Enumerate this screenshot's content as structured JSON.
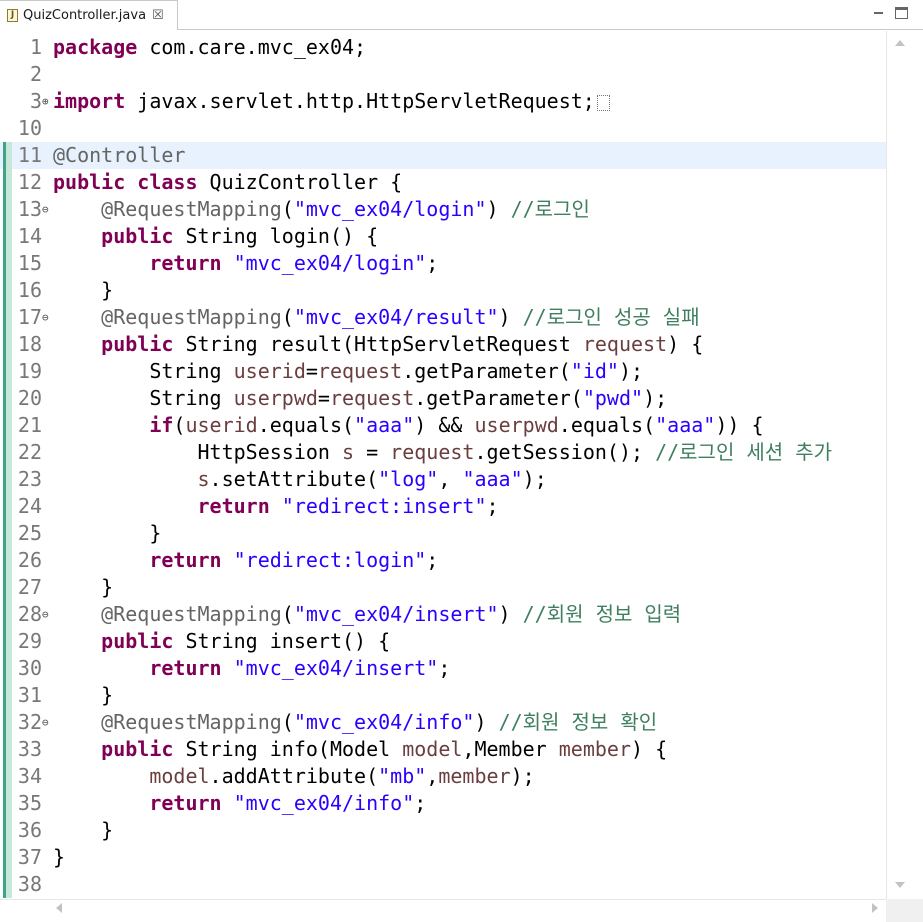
{
  "tab": {
    "file_name": "QuizController.java",
    "icon": "java-file-icon",
    "close_glyph": "☒"
  },
  "colors": {
    "keyword": "#7f0055",
    "string": "#2a00ff",
    "annotation": "#646464",
    "comment": "#3f7f5f",
    "field": "#6a3e3e",
    "current_line": "#e8f2fe"
  },
  "editor": {
    "current_line": 11,
    "lines": [
      {
        "n": "1",
        "t": [
          [
            "kw",
            "package"
          ],
          [
            "p",
            " com.care.mvc_ex04;"
          ]
        ]
      },
      {
        "n": "2",
        "t": []
      },
      {
        "n": "3",
        "fold": "⊕",
        "t": [
          [
            "kw",
            "import"
          ],
          [
            "p",
            " javax.servlet.http.HttpServletRequest;"
          ]
        ],
        "elided": true
      },
      {
        "n": "10",
        "t": []
      },
      {
        "n": "11",
        "t": [
          [
            "ann",
            "@Controller"
          ]
        ]
      },
      {
        "n": "12",
        "t": [
          [
            "kw",
            "public"
          ],
          [
            "p",
            " "
          ],
          [
            "kw",
            "class"
          ],
          [
            "p",
            " QuizController {"
          ]
        ]
      },
      {
        "n": "13",
        "fold": "⊖",
        "t": [
          [
            "p",
            "    "
          ],
          [
            "ann",
            "@RequestMapping"
          ],
          [
            "p",
            "("
          ],
          [
            "str",
            "\"mvc_ex04/login\""
          ],
          [
            "p",
            ") "
          ],
          [
            "cm",
            "//로그인"
          ]
        ]
      },
      {
        "n": "14",
        "t": [
          [
            "p",
            "    "
          ],
          [
            "kw",
            "public"
          ],
          [
            "p",
            " String login() {"
          ]
        ]
      },
      {
        "n": "15",
        "t": [
          [
            "p",
            "        "
          ],
          [
            "kw",
            "return"
          ],
          [
            "p",
            " "
          ],
          [
            "str",
            "\"mvc_ex04/login\""
          ],
          [
            "p",
            ";"
          ]
        ]
      },
      {
        "n": "16",
        "t": [
          [
            "p",
            "    }"
          ]
        ]
      },
      {
        "n": "17",
        "fold": "⊖",
        "t": [
          [
            "p",
            "    "
          ],
          [
            "ann",
            "@RequestMapping"
          ],
          [
            "p",
            "("
          ],
          [
            "str",
            "\"mvc_ex04/result\""
          ],
          [
            "p",
            ") "
          ],
          [
            "cm",
            "//로그인 성공 실패"
          ]
        ]
      },
      {
        "n": "18",
        "t": [
          [
            "p",
            "    "
          ],
          [
            "kw",
            "public"
          ],
          [
            "p",
            " String result(HttpServletRequest "
          ],
          [
            "fld",
            "request"
          ],
          [
            "p",
            ") {"
          ]
        ]
      },
      {
        "n": "19",
        "t": [
          [
            "p",
            "        String "
          ],
          [
            "fld",
            "userid"
          ],
          [
            "p",
            "="
          ],
          [
            "fld",
            "request"
          ],
          [
            "p",
            ".getParameter("
          ],
          [
            "str",
            "\"id\""
          ],
          [
            "p",
            ");"
          ]
        ]
      },
      {
        "n": "20",
        "t": [
          [
            "p",
            "        String "
          ],
          [
            "fld",
            "userpwd"
          ],
          [
            "p",
            "="
          ],
          [
            "fld",
            "request"
          ],
          [
            "p",
            ".getParameter("
          ],
          [
            "str",
            "\"pwd\""
          ],
          [
            "p",
            ");"
          ]
        ]
      },
      {
        "n": "21",
        "t": [
          [
            "p",
            "        "
          ],
          [
            "kw",
            "if"
          ],
          [
            "p",
            "("
          ],
          [
            "fld",
            "userid"
          ],
          [
            "p",
            ".equals("
          ],
          [
            "str",
            "\"aaa\""
          ],
          [
            "p",
            ") && "
          ],
          [
            "fld",
            "userpwd"
          ],
          [
            "p",
            ".equals("
          ],
          [
            "str",
            "\"aaa\""
          ],
          [
            "p",
            ")) {"
          ]
        ]
      },
      {
        "n": "22",
        "t": [
          [
            "p",
            "            HttpSession "
          ],
          [
            "fld",
            "s"
          ],
          [
            "p",
            " = "
          ],
          [
            "fld",
            "request"
          ],
          [
            "p",
            ".getSession(); "
          ],
          [
            "cm",
            "//로그인 세션 추가"
          ]
        ]
      },
      {
        "n": "23",
        "t": [
          [
            "p",
            "            "
          ],
          [
            "fld",
            "s"
          ],
          [
            "p",
            ".setAttribute("
          ],
          [
            "str",
            "\"log\""
          ],
          [
            "p",
            ", "
          ],
          [
            "str",
            "\"aaa\""
          ],
          [
            "p",
            ");"
          ]
        ]
      },
      {
        "n": "24",
        "t": [
          [
            "p",
            "            "
          ],
          [
            "kw",
            "return"
          ],
          [
            "p",
            " "
          ],
          [
            "str",
            "\"redirect:insert\""
          ],
          [
            "p",
            ";"
          ]
        ]
      },
      {
        "n": "25",
        "t": [
          [
            "p",
            "        }"
          ]
        ]
      },
      {
        "n": "26",
        "t": [
          [
            "p",
            "        "
          ],
          [
            "kw",
            "return"
          ],
          [
            "p",
            " "
          ],
          [
            "str",
            "\"redirect:login\""
          ],
          [
            "p",
            ";"
          ]
        ]
      },
      {
        "n": "27",
        "t": [
          [
            "p",
            "    }"
          ]
        ]
      },
      {
        "n": "28",
        "fold": "⊖",
        "t": [
          [
            "p",
            "    "
          ],
          [
            "ann",
            "@RequestMapping"
          ],
          [
            "p",
            "("
          ],
          [
            "str",
            "\"mvc_ex04/insert\""
          ],
          [
            "p",
            ") "
          ],
          [
            "cm",
            "//회원 정보 입력"
          ]
        ]
      },
      {
        "n": "29",
        "t": [
          [
            "p",
            "    "
          ],
          [
            "kw",
            "public"
          ],
          [
            "p",
            " String insert() {"
          ]
        ]
      },
      {
        "n": "30",
        "t": [
          [
            "p",
            "        "
          ],
          [
            "kw",
            "return"
          ],
          [
            "p",
            " "
          ],
          [
            "str",
            "\"mvc_ex04/insert\""
          ],
          [
            "p",
            ";"
          ]
        ]
      },
      {
        "n": "31",
        "t": [
          [
            "p",
            "    }"
          ]
        ]
      },
      {
        "n": "32",
        "fold": "⊖",
        "t": [
          [
            "p",
            "    "
          ],
          [
            "ann",
            "@RequestMapping"
          ],
          [
            "p",
            "("
          ],
          [
            "str",
            "\"mvc_ex04/info\""
          ],
          [
            "p",
            ") "
          ],
          [
            "cm",
            "//회원 정보 확인"
          ]
        ]
      },
      {
        "n": "33",
        "t": [
          [
            "p",
            "    "
          ],
          [
            "kw",
            "public"
          ],
          [
            "p",
            " String info(Model "
          ],
          [
            "fld",
            "model"
          ],
          [
            "p",
            ",Member "
          ],
          [
            "fld",
            "member"
          ],
          [
            "p",
            ") {"
          ]
        ]
      },
      {
        "n": "34",
        "t": [
          [
            "p",
            "        "
          ],
          [
            "fld",
            "model"
          ],
          [
            "p",
            ".addAttribute("
          ],
          [
            "str",
            "\"mb\""
          ],
          [
            "p",
            ","
          ],
          [
            "fld",
            "member"
          ],
          [
            "p",
            ");"
          ]
        ]
      },
      {
        "n": "35",
        "t": [
          [
            "p",
            "        "
          ],
          [
            "kw",
            "return"
          ],
          [
            "p",
            " "
          ],
          [
            "str",
            "\"mvc_ex04/info\""
          ],
          [
            "p",
            ";"
          ]
        ]
      },
      {
        "n": "36",
        "t": [
          [
            "p",
            "    }"
          ]
        ]
      },
      {
        "n": "37",
        "t": [
          [
            "p",
            "}"
          ]
        ]
      },
      {
        "n": "38",
        "t": []
      }
    ]
  }
}
